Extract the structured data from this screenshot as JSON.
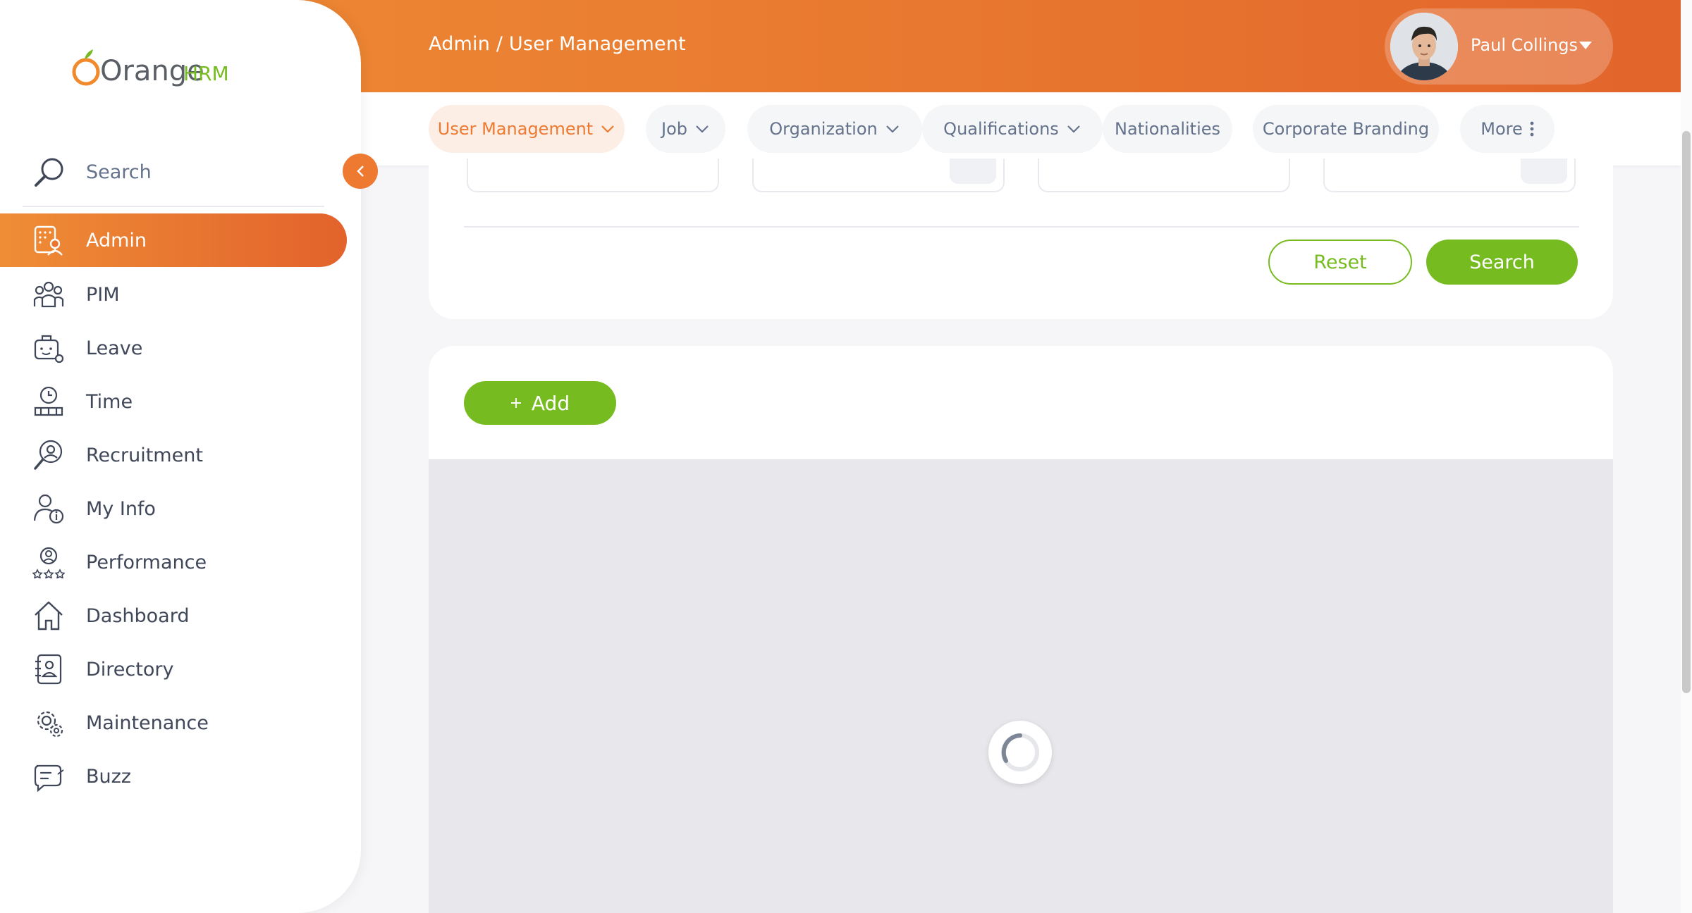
{
  "app": {
    "logo_text_main": "Orange",
    "logo_text_suffix": "HRM",
    "brand_color": "#ed7a30",
    "accent_green": "#76bc21"
  },
  "header": {
    "breadcrumb": "Admin / User Management",
    "user_name": "Paul Collings"
  },
  "subnav": {
    "tabs": [
      {
        "label": "User Management",
        "has_chevron": true,
        "active": true
      },
      {
        "label": "Job",
        "has_chevron": true
      },
      {
        "label": "Organization",
        "has_chevron": true
      },
      {
        "label": "Qualifications",
        "has_chevron": true
      },
      {
        "label": "Nationalities"
      },
      {
        "label": "Corporate Branding"
      },
      {
        "label": "More",
        "icon": "kebab-icon"
      }
    ]
  },
  "sidebar": {
    "search_label": "Search",
    "items": [
      {
        "label": "Admin",
        "icon": "admin-icon",
        "active": true
      },
      {
        "label": "PIM",
        "icon": "pim-icon"
      },
      {
        "label": "Leave",
        "icon": "leave-icon"
      },
      {
        "label": "Time",
        "icon": "time-icon"
      },
      {
        "label": "Recruitment",
        "icon": "recruitment-icon"
      },
      {
        "label": "My Info",
        "icon": "my-info-icon"
      },
      {
        "label": "Performance",
        "icon": "performance-icon"
      },
      {
        "label": "Dashboard",
        "icon": "dashboard-icon"
      },
      {
        "label": "Directory",
        "icon": "directory-icon"
      },
      {
        "label": "Maintenance",
        "icon": "maintenance-icon"
      },
      {
        "label": "Buzz",
        "icon": "buzz-icon"
      }
    ]
  },
  "filters": {
    "reset_label": "Reset",
    "search_label": "Search"
  },
  "records": {
    "add_label": "Add",
    "add_icon": "plus-icon",
    "status": "loading"
  }
}
